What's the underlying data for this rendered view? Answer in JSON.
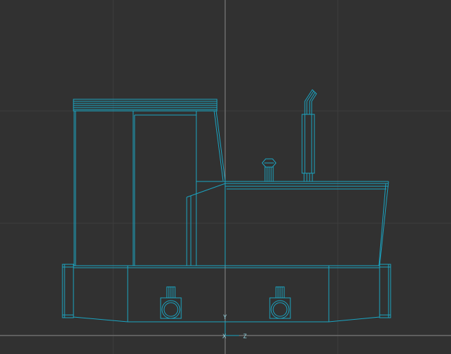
{
  "viewport": {
    "view_name": "Side",
    "background_color": "#313131",
    "grid_color": "#3d3d3d",
    "origin_axis_color": "#8a8a8a",
    "wire_color": "#1aa6c4",
    "wire_color_dark": "#128aa6"
  },
  "axis_gizmo": {
    "y_label": "Y",
    "x_label": "X",
    "z_label": "Z"
  },
  "model": {
    "name": "locomotive-wireframe",
    "parts": [
      "cab",
      "roof",
      "hood",
      "exhaust-stack",
      "cap",
      "chassis",
      "wheel-front",
      "wheel-rear",
      "buffer-left",
      "buffer-right"
    ]
  }
}
